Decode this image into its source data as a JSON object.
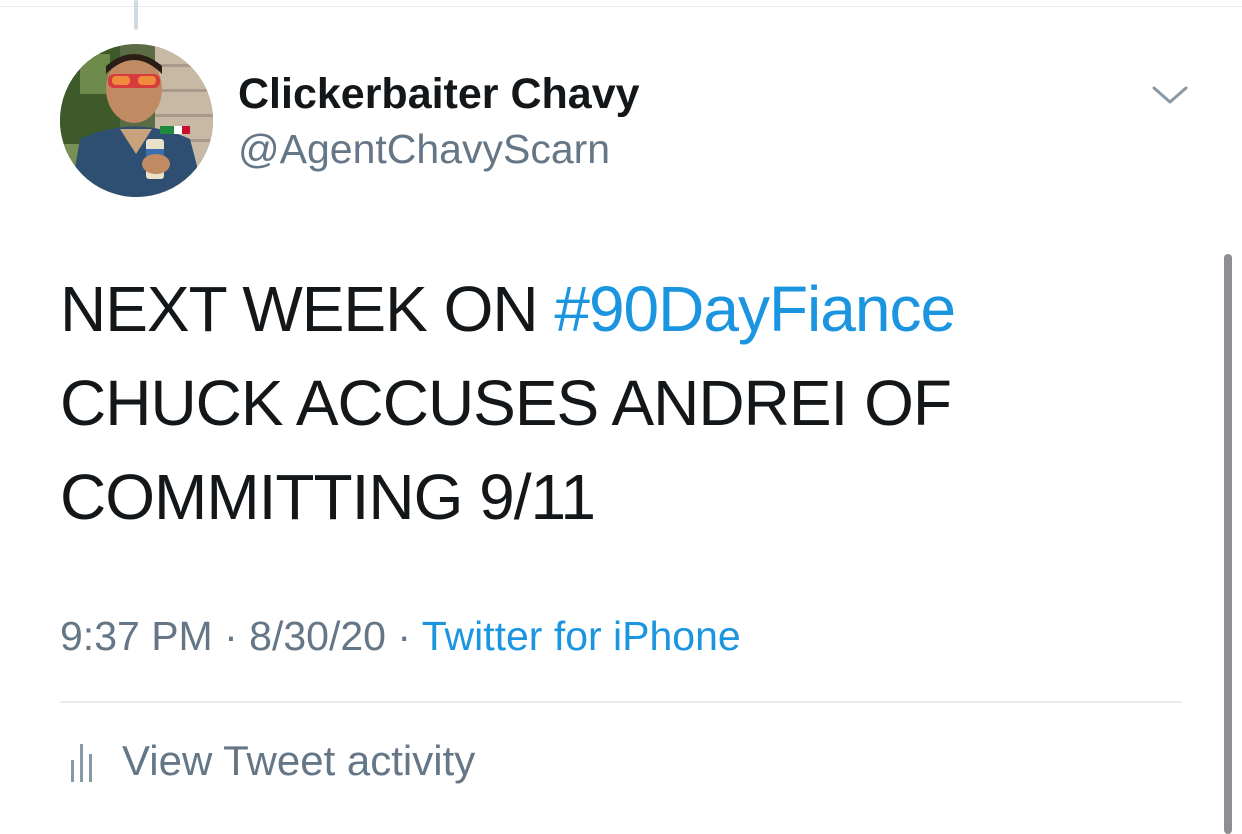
{
  "tweet": {
    "author": {
      "display_name": "Clickerbaiter Chavy",
      "handle": "@AgentChavyScarn"
    },
    "text_lines": [
      {
        "before": "NEXT WEEK ON ",
        "hashtag": "#90DayFiance"
      },
      {
        "text": "CHUCK ACCUSES ANDREI OF"
      },
      {
        "text": "COMMITTING 9/11"
      }
    ],
    "meta": {
      "time": "9:37 PM",
      "separator": "·",
      "date": "8/30/20",
      "source": "Twitter for iPhone"
    },
    "activity_label": "View Tweet activity"
  },
  "icons": {
    "caret": "chevron-down-icon",
    "activity": "bar-chart-icon"
  },
  "colors": {
    "link": "#1b95e0",
    "secondary_text": "#657786",
    "primary_text": "#14171a",
    "divider": "#e6ecf0"
  }
}
